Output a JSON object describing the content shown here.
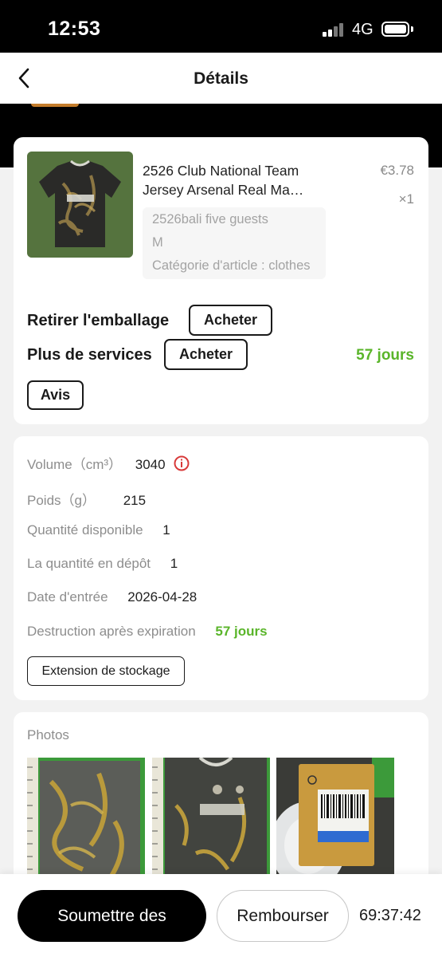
{
  "status_bar": {
    "time": "12:53",
    "network": "4G",
    "icons": [
      "signal-bars-icon",
      "battery-icon"
    ]
  },
  "header": {
    "title": "Détails",
    "back_icon": "chevron-left-icon"
  },
  "product": {
    "name": "2526 Club National Team Jersey Arsenal Real Ma…",
    "price": "€3.78",
    "quantity": "×1",
    "attributes": [
      "2526bali five guests",
      "M",
      "Catégorie d'article : clothes"
    ],
    "image_icon": "jersey-photo"
  },
  "services": {
    "remove_packaging_label": "Retirer l'emballage",
    "remove_packaging_button": "Acheter",
    "more_services_label": "Plus de services",
    "more_services_button": "Acheter",
    "days_left": "57 jours",
    "review_button": "Avis"
  },
  "storage_info": {
    "rows": [
      {
        "label": "Volume（cm³）",
        "value": "3040"
      },
      {
        "label": "Poids（g）",
        "value": "215"
      },
      {
        "label": "Quantité disponible",
        "value": "1"
      },
      {
        "label": "La quantité en dépôt",
        "value": "1"
      },
      {
        "label": "Date d'entrée",
        "value": "2026-04-28"
      },
      {
        "label": "Destruction après expiration",
        "value": "57 jours"
      }
    ],
    "volume_alert_icon": "info-circle-icon",
    "extend_button": "Extension de stockage"
  },
  "photos": {
    "title": "Photos",
    "items": [
      "jersey-flat-photo",
      "jersey-front-photo",
      "jersey-tag-photo"
    ]
  },
  "bottom_bar": {
    "submit_button": "Soumettre des",
    "refund_button": "Rembourser",
    "countdown": "69:37:42"
  },
  "colors": {
    "accent_green": "#5ab52a",
    "alert_red": "#d83a3a",
    "primary_black": "#000000",
    "orange_tab": "#c47d2c"
  }
}
